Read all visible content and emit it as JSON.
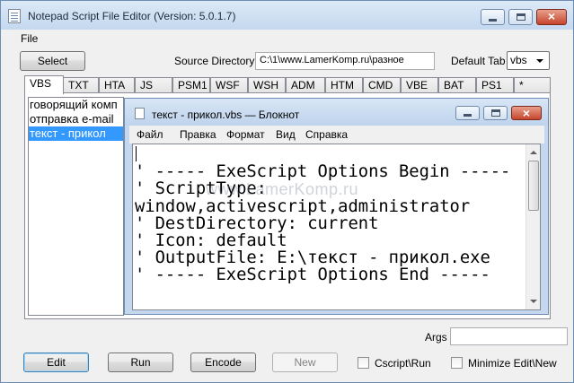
{
  "window": {
    "title": "Notepad Script File Editor (Version: 5.0.1.7)"
  },
  "menubar": {
    "file": "File"
  },
  "toolbar": {
    "select_label": "Select",
    "source_dir_label": "Source Directory",
    "source_dir_value": "C:\\1\\www.LamerKomp.ru\\разное",
    "default_tab_label": "Default Tab",
    "default_tab_value": "vbs"
  },
  "tabs": [
    "VBS",
    "TXT",
    "HTA",
    "JS",
    "PSM1",
    "WSF",
    "WSH",
    "ADM",
    "HTM",
    "CMD",
    "VBE",
    "BAT",
    "PS1",
    "*"
  ],
  "active_tab": "VBS",
  "files": [
    {
      "label": "говорящий комп",
      "selected": false
    },
    {
      "label": "отправка e-mail",
      "selected": false
    },
    {
      "label": "текст - прикол",
      "selected": true
    }
  ],
  "notepad": {
    "title": "текст - прикол.vbs — Блокнот",
    "menu": [
      "Файл",
      "Правка",
      "Формат",
      "Вид",
      "Справка"
    ],
    "lines": [
      "",
      "' ----- ExeScript Options Begin -----",
      "' ScriptType:",
      "window,activescript,administrator",
      "' DestDirectory: current",
      "' Icon: default",
      "' OutputFile: E:\\текст - прикол.exe",
      "' ----- ExeScript Options End -----"
    ]
  },
  "watermark": "www.LamerKomp.ru",
  "bottom": {
    "args_label": "Args",
    "args_value": "",
    "edit_label": "Edit",
    "run_label": "Run",
    "encode_label": "Encode",
    "new_label": "New",
    "cscript_label": "Cscript\\Run",
    "minimize_label": "Minimize Edit\\New"
  }
}
